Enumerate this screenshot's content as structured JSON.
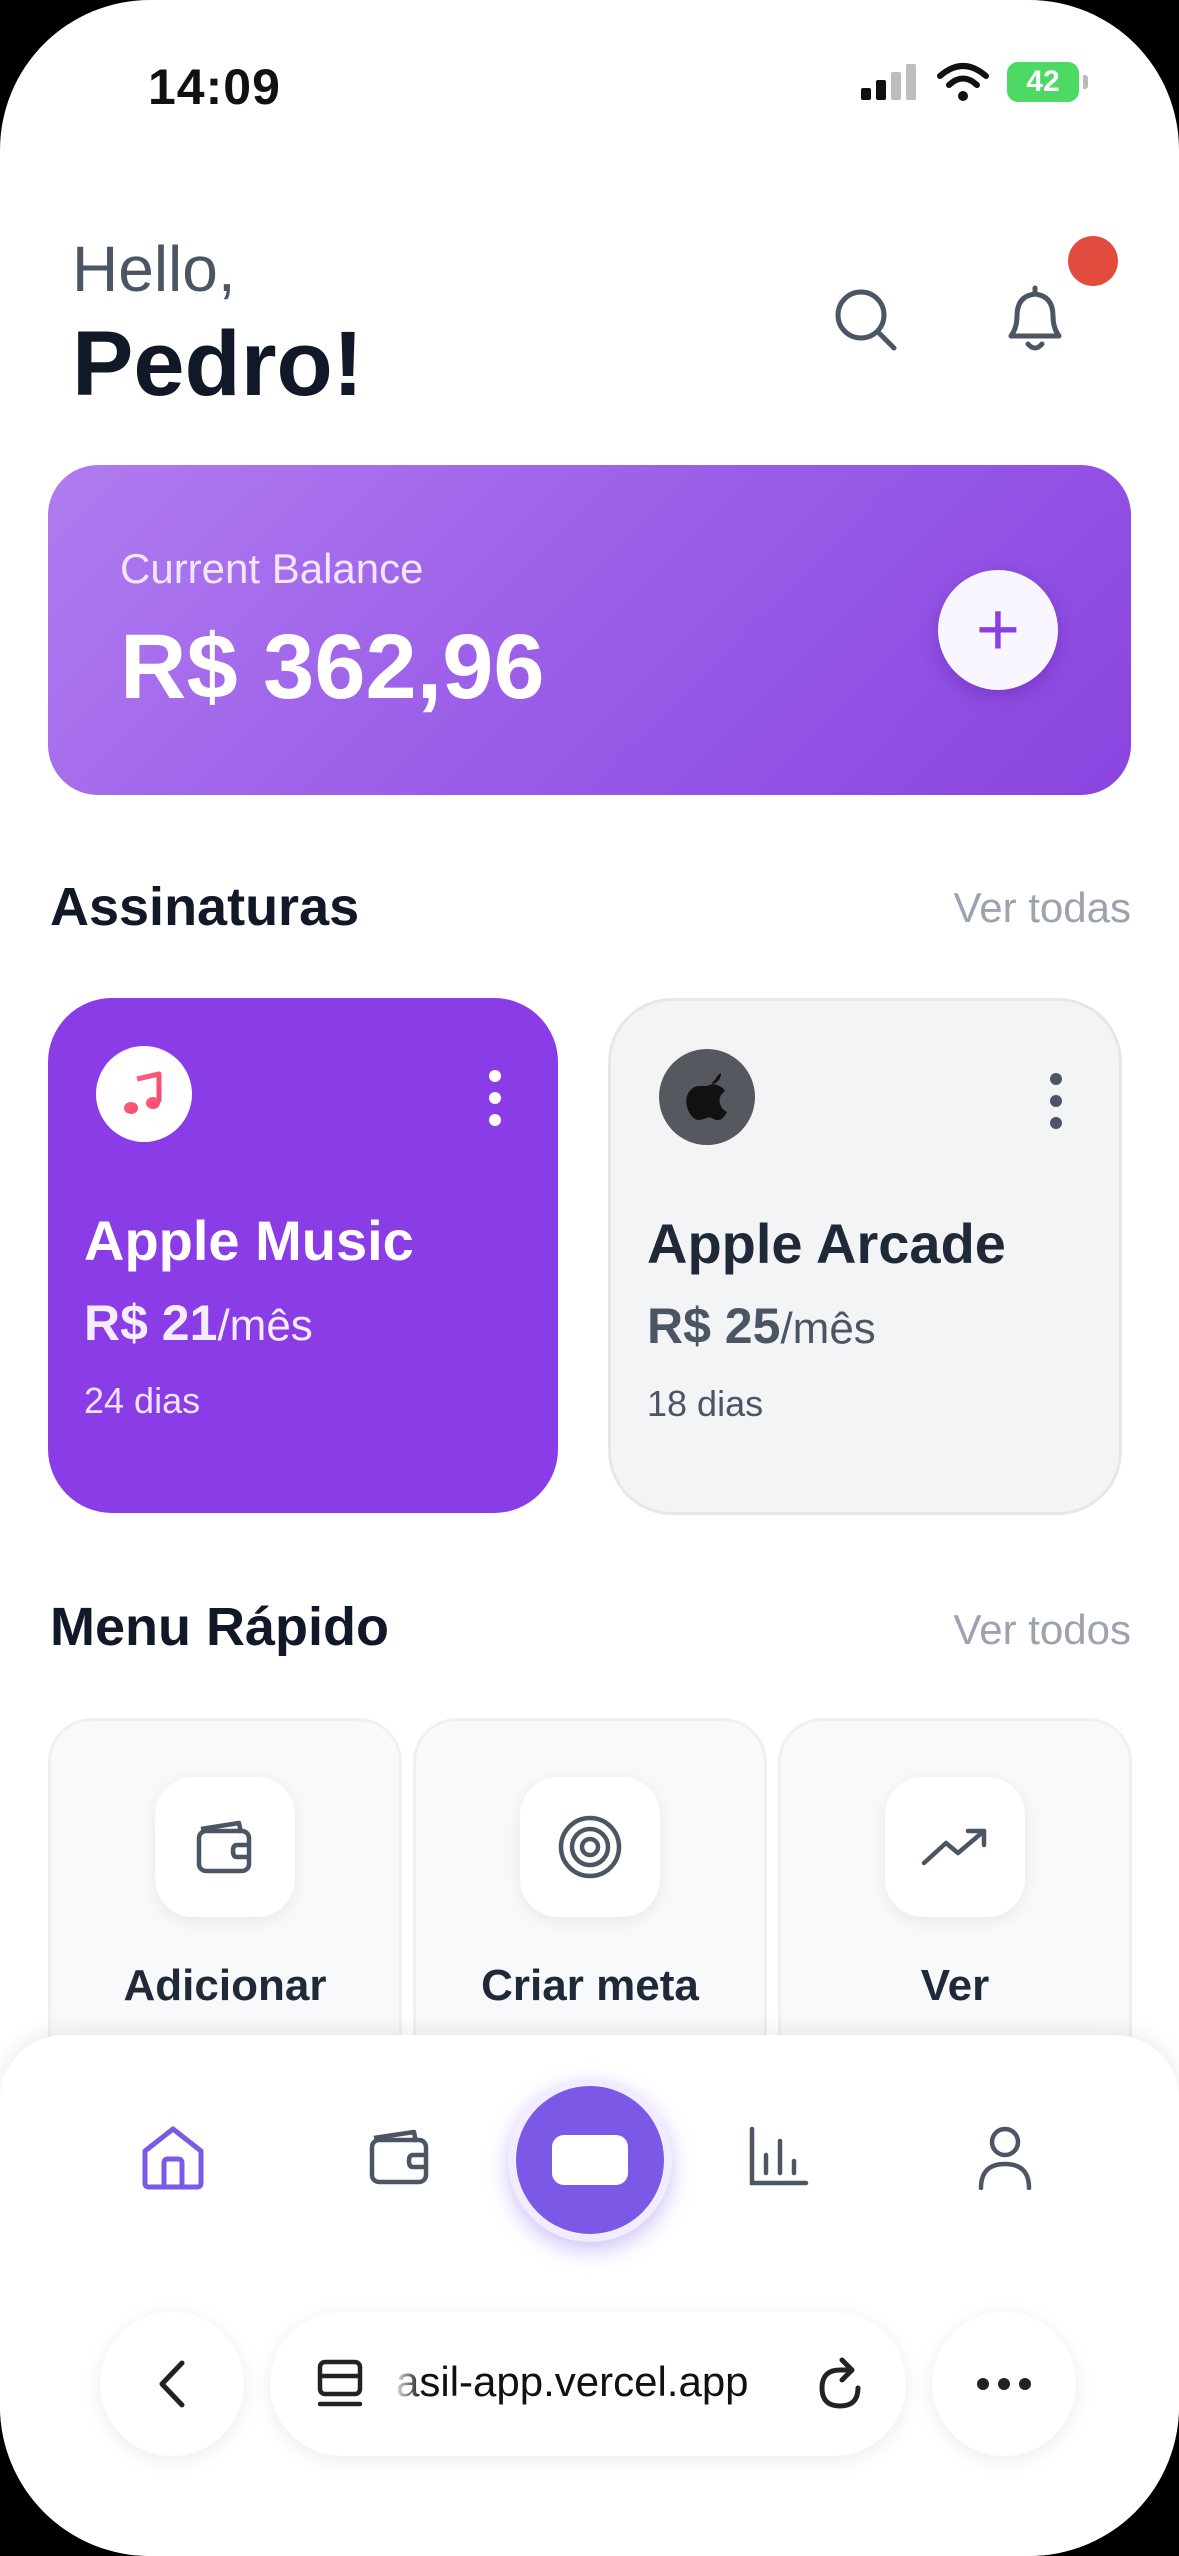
{
  "status_bar": {
    "time": "14:09",
    "battery": "42"
  },
  "header": {
    "greeting": "Hello,",
    "user_name": "Pedro!"
  },
  "balance": {
    "label": "Current Balance",
    "value": "R$ 362,96",
    "add_symbol": "+"
  },
  "subscriptions": {
    "title": "Assinaturas",
    "link": "Ver todas",
    "items": [
      {
        "name": "Apple Music",
        "price": "R$ 21",
        "period": "/mês",
        "days": "24 dias",
        "icon": "music-note-icon",
        "color": "#8a3ce6"
      },
      {
        "name": "Apple Arcade",
        "price": "R$ 25",
        "period": "/mês",
        "days": "18 dias",
        "icon": "apple-logo-icon",
        "color": "#f3f4f6"
      }
    ]
  },
  "quick_menu": {
    "title": "Menu Rápido",
    "link": "Ver todos",
    "items": [
      {
        "label": "Adicionar",
        "icon": "wallet-icon"
      },
      {
        "label": "Criar meta",
        "icon": "target-icon"
      },
      {
        "label": "Ver",
        "icon": "trending-up-icon"
      }
    ]
  },
  "bottom_nav": {
    "items": [
      "home-icon",
      "wallet-icon",
      "card-icon",
      "bar-chart-icon",
      "user-icon"
    ],
    "active": "home-icon"
  },
  "browser": {
    "url": "asil-app.vercel.app"
  },
  "colors": {
    "primary": "#8a3ce6",
    "nav_center": "#7b58e6",
    "notification": "#e24c3f",
    "battery": "#4cd964"
  }
}
